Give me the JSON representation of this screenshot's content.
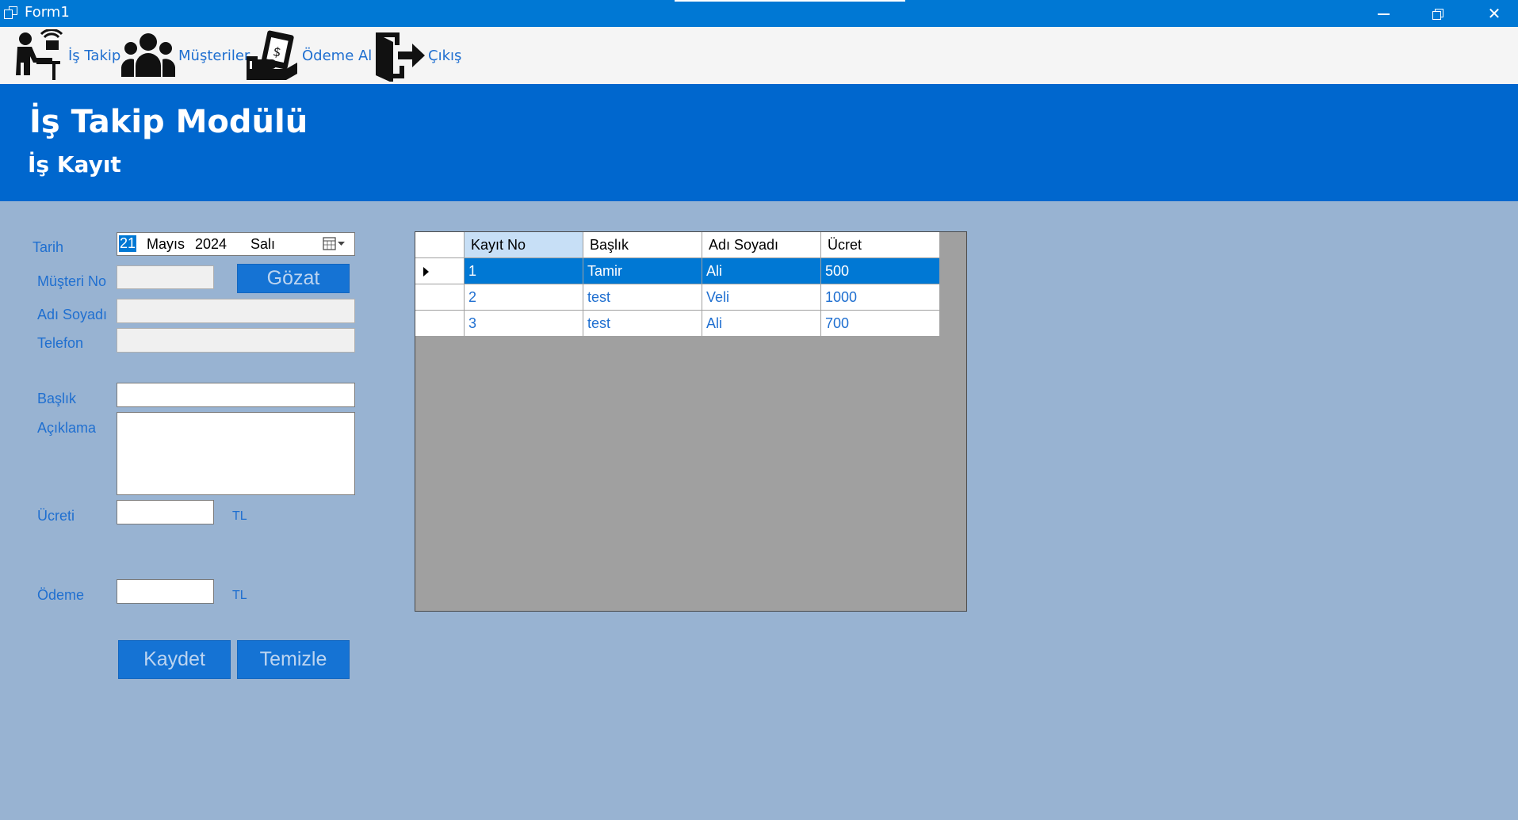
{
  "window": {
    "title": "Form1"
  },
  "toolbar": {
    "items": [
      {
        "label": "İş Takip",
        "icon": "worker-desk-icon"
      },
      {
        "label": "Müşteriler",
        "icon": "users-group-icon"
      },
      {
        "label": "Ödeme Al",
        "icon": "money-payment-icon"
      },
      {
        "label": "Çıkış",
        "icon": "exit-door-icon"
      }
    ]
  },
  "header": {
    "title": "İş Takip Modülü",
    "subtitle": "İş Kayıt"
  },
  "form": {
    "tarih_label": "Tarih",
    "date": {
      "day": "21",
      "month": "Mayıs",
      "year": "2024",
      "weekday": "Salı"
    },
    "musteri_no_label": "Müşteri No",
    "musteri_no_value": "",
    "gozat_label": "Gözat",
    "adi_soyadi_label": "Adı Soyadı",
    "adi_soyadi_value": "",
    "telefon_label": "Telefon",
    "telefon_value": "",
    "baslik_label": "Başlık",
    "baslik_value": "",
    "aciklama_label": "Açıklama",
    "aciklama_value": "",
    "ucreti_label": "Ücreti",
    "ucreti_value": "",
    "ucreti_unit": "TL",
    "odeme_label": "Ödeme",
    "odeme_value": "",
    "odeme_unit": "TL",
    "kaydet_label": "Kaydet",
    "temizle_label": "Temizle"
  },
  "grid": {
    "columns": [
      "Kayıt No",
      "Başlık",
      "Adı Soyadı",
      "Ücret"
    ],
    "rows": [
      [
        "1",
        "Tamir",
        "Ali",
        "500"
      ],
      [
        "2",
        "test",
        "Veli",
        "1000"
      ],
      [
        "3",
        "test",
        "Ali",
        "700"
      ]
    ],
    "selected_row": 0
  },
  "colors": {
    "titlebar": "#0078d4",
    "header": "#0067ce",
    "background": "#98b3d2",
    "accent_text": "#1f6fd0",
    "button": "#1573d4"
  }
}
